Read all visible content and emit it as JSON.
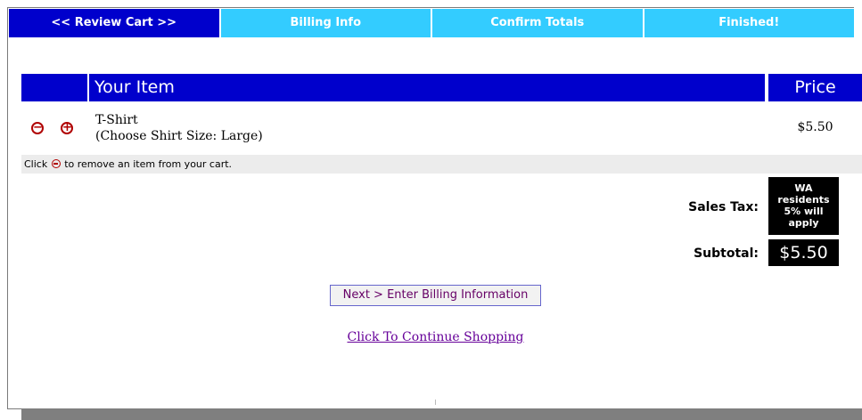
{
  "steps": [
    {
      "label": "<< Review Cart >>",
      "active": true
    },
    {
      "label": "Billing Info",
      "active": false
    },
    {
      "label": "Confirm Totals",
      "active": false
    },
    {
      "label": "Finished!",
      "active": false
    }
  ],
  "cart": {
    "header_item": "Your Item",
    "header_price": "Price",
    "items": [
      {
        "name": "T-Shirt",
        "option": "(Choose Shirt Size: Large)",
        "price": "$5.50",
        "remove_icon": "minus-circle-icon",
        "add_icon": "plus-circle-icon"
      }
    ],
    "hint_before": "Click",
    "hint_after": "to remove an item from your cart."
  },
  "totals": {
    "sales_tax_label": "Sales Tax:",
    "sales_tax_note_lines": [
      "WA",
      "residents",
      "5% will",
      "apply"
    ],
    "subtotal_label": "Subtotal:",
    "subtotal_value": "$5.50"
  },
  "actions": {
    "next_label": "Next > Enter Billing Information",
    "continue_label": "Click To Continue Shopping"
  },
  "colors": {
    "active_step": "#0000cc",
    "inactive_step": "#33ccff",
    "header_bg": "#0000cc",
    "icon_red": "#b00000",
    "link_purple": "#660099"
  }
}
